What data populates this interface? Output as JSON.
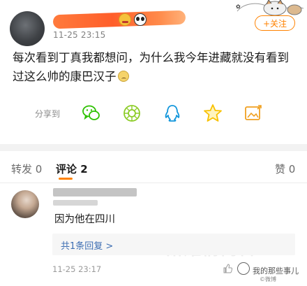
{
  "post": {
    "timestamp": "11-25 23:15",
    "follow_label": "+关注",
    "text": "每次看到丁真我都想问，为什么我今年进藏就没有看到过这么帅的康巴汉子"
  },
  "share": {
    "label": "分享到",
    "icons": [
      "wechat-icon",
      "moments-icon",
      "qq-icon",
      "qzone-star-icon",
      "picture-share-icon"
    ]
  },
  "tabs": {
    "repost": "转发 0",
    "comments": "评论 2",
    "likes": "赞 0"
  },
  "comment": {
    "text": "因为他在四川",
    "reply_link": "共1条回复 >",
    "time": "11-25 23:17"
  },
  "watermarks": {
    "center": "萧耀情商日",
    "channel": "我的那些事儿",
    "handle": "©微博"
  },
  "colors": {
    "accent": "#ff8200",
    "link": "#3d6eb3",
    "wechat": "#2dc100",
    "qq": "#1296db",
    "star": "#f8c100"
  }
}
